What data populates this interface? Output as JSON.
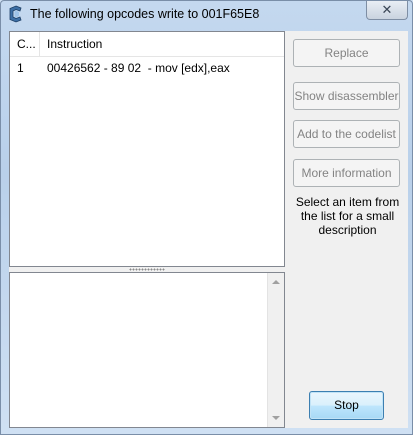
{
  "window": {
    "title": "The following opcodes write to 001F65E8",
    "close_glyph": "✕"
  },
  "list": {
    "columns": [
      "C...",
      "Instruction"
    ],
    "rows": [
      {
        "count": "1",
        "instruction": "00426562 - 89 02  - mov [edx],eax"
      }
    ]
  },
  "buttons": {
    "replace": "Replace",
    "show_disassembler": "Show disassembler",
    "add_to_codelist": "Add to the codelist",
    "more_information": "More information",
    "stop": "Stop"
  },
  "hint": "Select an item from the list for a small description",
  "icons": {
    "app": "cheat-engine-icon",
    "close": "close-icon"
  },
  "colors": {
    "disabled_text": "#838383",
    "stop_button": "#bee6fd",
    "title_bg": "#b9d0ea"
  }
}
